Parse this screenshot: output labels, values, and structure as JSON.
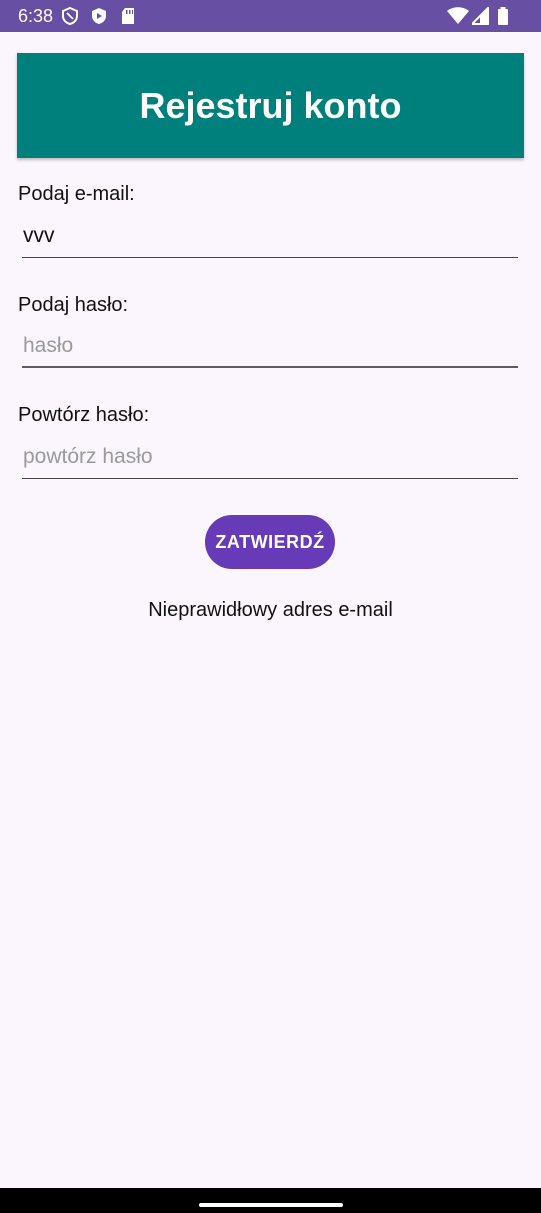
{
  "status_bar": {
    "time": "6:38",
    "left_icons": [
      "shield-outline-icon",
      "shield-icon",
      "sd-card-icon"
    ],
    "right_icons": [
      "wifi-icon",
      "signal-icon",
      "battery-icon"
    ],
    "background": "#6750a4"
  },
  "header": {
    "title": "Rejestruj konto",
    "background": "#00807d"
  },
  "form": {
    "email_label": "Podaj e-mail:",
    "email_value": "vvv",
    "password_label": "Podaj hasło:",
    "password_placeholder": "hasło",
    "repeat_label": "Powtórz hasło:",
    "repeat_placeholder": "powtórz hasło",
    "submit_label": "ZATWIERDŹ",
    "submit_color": "#673ab7"
  },
  "error_message": "Nieprawidłowy adres e-mail"
}
